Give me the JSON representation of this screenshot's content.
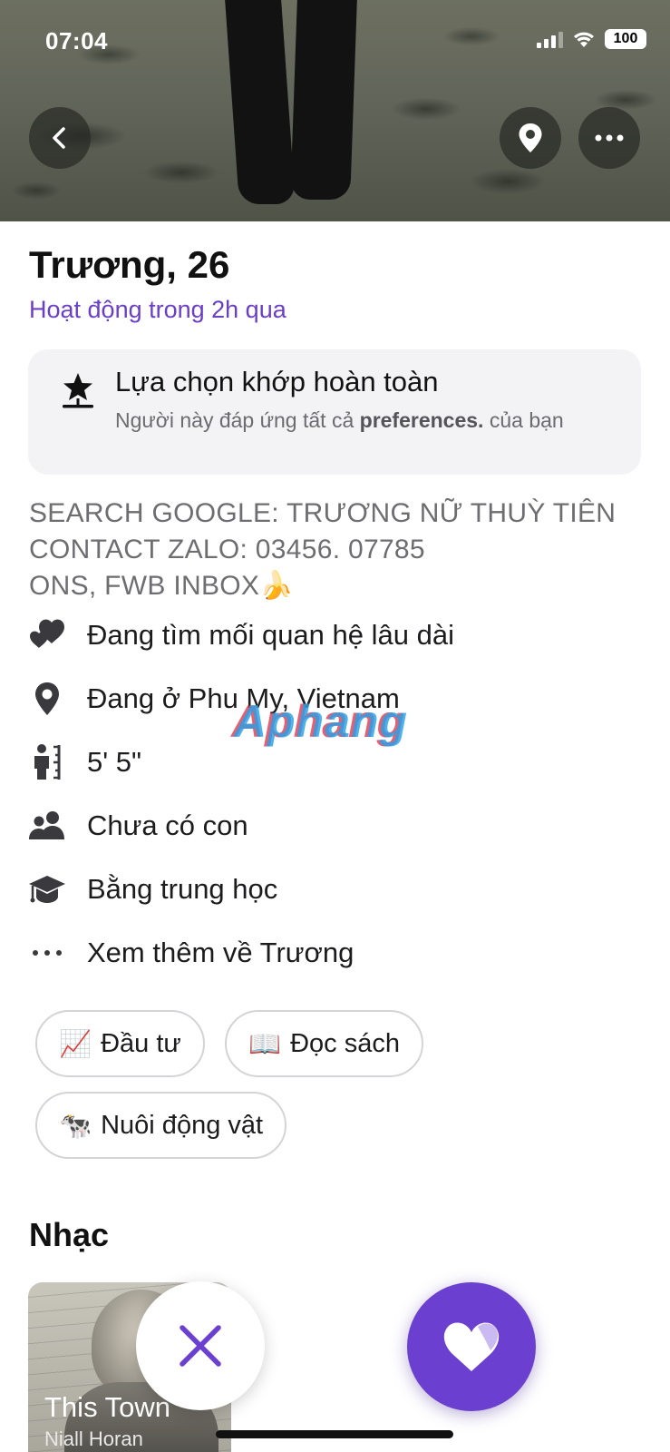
{
  "status_bar": {
    "time": "07:04",
    "battery": "100"
  },
  "header": {
    "back_icon": "chevron-left-icon",
    "location_icon": "map-pin-icon",
    "more_icon": "more-horizontal-icon"
  },
  "profile": {
    "name_age": "Trương, 26",
    "activity": "Hoạt động trong 2h qua"
  },
  "match_card": {
    "icon": "star-match-icon",
    "title": "Lựa chọn khớp hoàn toàn",
    "desc_prefix": "Người này đáp ứng tất cả ",
    "desc_bold": "preferences.",
    "desc_suffix": " của bạn"
  },
  "bio": {
    "line1": "SEARCH GOOGLE: TRƯƠNG NỮ THUỲ TIÊN",
    "line2": "CONTACT ZALO:  03456. 07785",
    "line3": "ONS, FWB INBOX🍌"
  },
  "details": [
    {
      "icon": "hearts-icon",
      "text": "Đang tìm mối quan hệ lâu dài"
    },
    {
      "icon": "location-pin-icon",
      "text": "Đang ở Phu My, Vietnam"
    },
    {
      "icon": "height-icon",
      "text": "5' 5\""
    },
    {
      "icon": "people-icon",
      "text": "Chưa có con"
    },
    {
      "icon": "graduation-cap-icon",
      "text": "Bằng trung học"
    },
    {
      "icon": "ellipsis-icon",
      "text": "Xem thêm về Trương"
    }
  ],
  "interests": [
    {
      "emoji": "📈",
      "label": "Đầu tư"
    },
    {
      "emoji": "📖",
      "label": "Đọc sách"
    },
    {
      "emoji": "🐄",
      "label": "Nuôi động vật"
    }
  ],
  "music": {
    "section_title": "Nhạc",
    "song": "This Town",
    "artist": "Niall Horan"
  },
  "actions": {
    "pass_icon": "close-icon",
    "like_icon": "heart-icon"
  },
  "watermark": "Aphang",
  "colors": {
    "accent": "#6b3fd0",
    "activity_text": "#6a3fc6",
    "card_bg": "#f3f3f5"
  }
}
